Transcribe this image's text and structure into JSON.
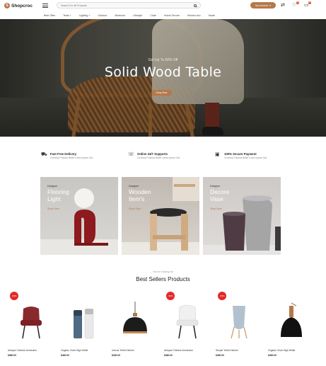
{
  "header": {
    "logo_text": "Shopcroc",
    "search_placeholder": "Search For All Products",
    "account_label": "My Account",
    "cart_badge": "0",
    "wishlist_badge": "0"
  },
  "nav": [
    "Best Offer",
    "Tents +",
    "Lighting +",
    "Outdoor",
    "Bedroom",
    "Lifestyle",
    "Chair",
    "Home Decore",
    "Kitchen Acc",
    "Mode"
  ],
  "hero": {
    "subtitle": "Get Up To 50% Off",
    "title": "Solid Wood Table",
    "button": "Shop Now"
  },
  "features": [
    {
      "icon": "truck-icon",
      "title": "Fast Free Delivery",
      "desc": "Contrary Popular Belief Lorem Ipsum Not"
    },
    {
      "icon": "support-icon",
      "title": "Online 24/7 Supports",
      "desc": "Contrary Popular Belief Lorem Ipsum Not"
    },
    {
      "icon": "secure-payment-icon",
      "title": "100% Secure Payment",
      "desc": "Contrary Popular Belief Lorem Ipsum Not"
    }
  ],
  "categories": [
    {
      "tag": "Designer",
      "title_line1": "Flooring",
      "title_line2": "Light",
      "link": "Shop Now"
    },
    {
      "tag": "Designer",
      "title_line1": "Wooden",
      "title_line2": "Item's",
      "link": "Shop Now"
    },
    {
      "tag": "Designer",
      "title_line1": "Decore",
      "title_line2": "Vase",
      "link": "Shop Now"
    }
  ],
  "best_sellers": {
    "subtitle": "You're looking for",
    "title": "Best Sellers Products"
  },
  "products": [
    {
      "name": "Antique Chinese Armchairs",
      "price": "$380.00",
      "old_price": "",
      "sale": "-50%"
    },
    {
      "name": "Organic Chair High White",
      "price": "$490.00",
      "old_price": "",
      "sale": ""
    },
    {
      "name": "Unicus Teeth Kitchen",
      "price": "$180.00",
      "old_price": "",
      "sale": ""
    },
    {
      "name": "Antique Chinese Armchairs",
      "price": "$380.00",
      "old_price": "",
      "sale": "-50%"
    },
    {
      "name": "Simple Teeth Kitchen",
      "price": "$490.00",
      "old_price": "",
      "sale": "-50%"
    },
    {
      "name": "Organic Chair High White",
      "price": "$490.00",
      "old_price": "",
      "sale": ""
    }
  ],
  "colors": {
    "accent": "#b5784a",
    "sale": "#e2292c"
  }
}
